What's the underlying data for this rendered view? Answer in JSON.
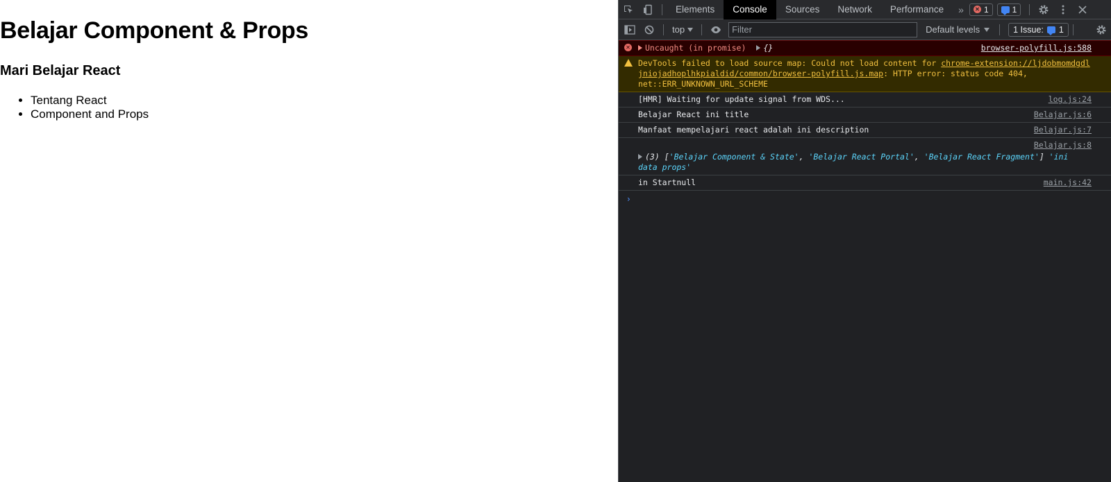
{
  "page": {
    "title": "Belajar Component & Props",
    "subtitle": "Mari Belajar React",
    "list": [
      "Tentang React",
      "Component and Props"
    ]
  },
  "devtools": {
    "tabs": [
      "Elements",
      "Console",
      "Sources",
      "Network",
      "Performance"
    ],
    "active_tab": "Console",
    "more_tabs": "»",
    "error_count": "1",
    "message_count": "1",
    "toolbar": {
      "context": "top",
      "filter_placeholder": "Filter",
      "levels": "Default levels",
      "issues_label": "1 Issue:",
      "issues_count": "1"
    },
    "console": {
      "error": {
        "text": "Uncaught (in promise)",
        "obj": "{}",
        "source": "browser-polyfill.js:588"
      },
      "warning": {
        "prefix": "DevTools failed to load source map: Could not load content for ",
        "link": "chrome-extension://ljdobmomdgdljniojadhoplhkpialdid/common/browser-polyfill.js.map",
        "suffix": ": HTTP error: status code 404, net::ERR_UNKNOWN_URL_SCHEME"
      },
      "logs": [
        {
          "text": "[HMR] Waiting for update signal from WDS...",
          "source": "log.js:24"
        },
        {
          "text": "Belajar React ini title",
          "source": "Belajar.js:6"
        },
        {
          "text": "Manfaat mempelajari react adalah ini description",
          "source": "Belajar.js:7"
        }
      ],
      "array_log": {
        "source": "Belajar.js:8",
        "count": "(3)",
        "items": [
          "'Belajar Component & State'",
          "'Belajar React Portal'",
          "'Belajar React Fragment'"
        ],
        "tail": "'ini data props'"
      },
      "last_log": {
        "text": "in Startnull",
        "source": "main.js:42"
      },
      "prompt": "›"
    }
  },
  "colors": {
    "devtools_bg": "#202124",
    "error_bg": "#290000",
    "warning_bg": "#332b00",
    "warning_text": "#f2c03f",
    "string_color": "#5cd5fb"
  }
}
